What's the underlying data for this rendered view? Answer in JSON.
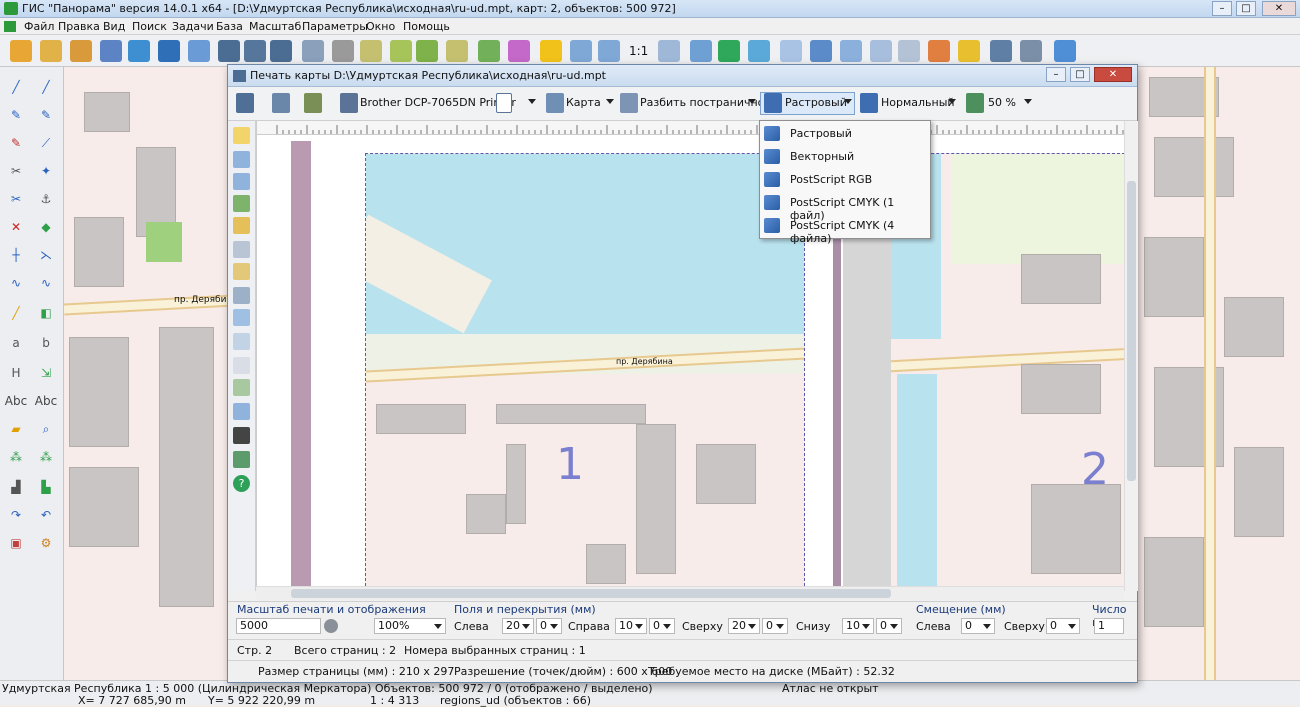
{
  "app": {
    "title": "ГИС \"Панорама\" версия 14.0.1 x64 - [D:\\Удмуртская Республика\\исходная\\ru-ud.mpt, карт: 2, объектов: 500 972]"
  },
  "menu": [
    "Файл",
    "Правка",
    "Вид",
    "Поиск",
    "Задачи",
    "База",
    "Масштаб",
    "Параметры",
    "Окно",
    "Помощь"
  ],
  "main_toolbar": {
    "scale_label": "1:1"
  },
  "left_toolbar": {
    "h_label": "H",
    "abc1": "Abc",
    "abc2": "Abc"
  },
  "map": {
    "street_label": "пр. Дерябина"
  },
  "dialog": {
    "title": "Печать карты D:\\Удмуртская Республика\\исходная\\ru-ud.mpt",
    "printer": "Brother DCP-7065DN Printer",
    "map_button": "Карта",
    "split_button": "Разбить постранично",
    "mode_button": "Растровый",
    "quality_button": "Нормальный",
    "zoom": "50 %",
    "pages": [
      "1",
      "2"
    ],
    "street_label_preview": "пр. Дерябина"
  },
  "mode_menu": [
    "Растровый",
    "Векторный",
    "PostScript RGB",
    "PostScript CMYK (1 файл)",
    "PostScript CMYK (4 файла)"
  ],
  "params": {
    "scale_group": "Масштаб печати и отображения",
    "scale_value": "5000",
    "display_pct": "100%",
    "margins_group": "Поля и перекрытия (мм)",
    "left_label": "Слева",
    "left_val1": "20",
    "left_val2": "0",
    "right_label": "Справа",
    "right_val1": "10",
    "right_val2": "0",
    "top_label": "Сверху",
    "top_val1": "20",
    "top_val2": "0",
    "bottom_label": "Снизу",
    "bottom_val1": "10",
    "bottom_val2": "0",
    "offset_group": "Смещение (мм)",
    "off_left_label": "Слева",
    "off_left_val": "0",
    "off_top_label": "Сверху",
    "off_top_val": "0",
    "count_group": "Число ко",
    "count_val": "1"
  },
  "info": {
    "page": "Стр. 2",
    "total_pages": "Всего страниц : 2",
    "selected_pages": "Номера выбранных страниц : 1",
    "page_size": "Размер страницы (мм) : 210 x 297",
    "resolution": "Разрешение (точек/дюйм) : 600 x 600",
    "disk_space": "Требуемое место на диске (МБайт) : 52.32"
  },
  "status": {
    "line1": "Удмуртская Республика  1 : 5 000  (Цилиндрическая Меркатора) Объектов: 500 972 / 0 (отображено / выделено)",
    "atlas": "Атлас не открыт",
    "x": "X= 7 727 685,90 m",
    "y": "Y= 5 922 220,99 m",
    "scale": "1 : 4 313",
    "layer": "regions_ud   (объектов : 66)"
  }
}
